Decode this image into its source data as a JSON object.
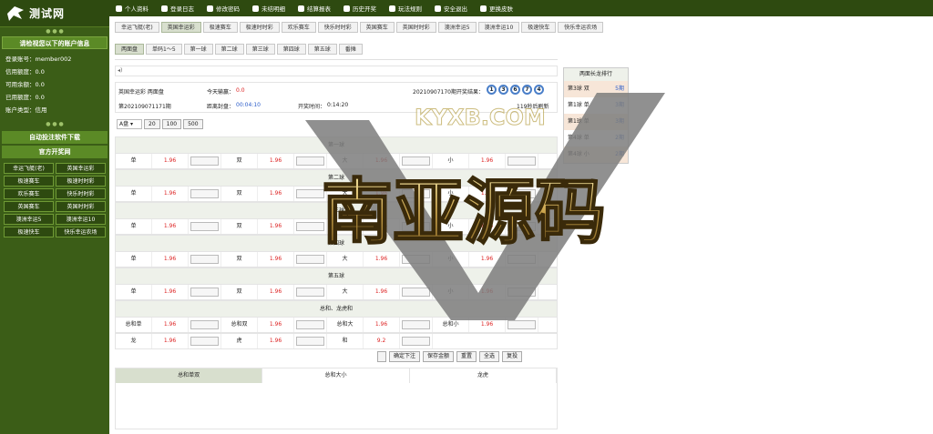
{
  "logo": {
    "name": "测试网"
  },
  "sidebar": {
    "acct_title": "请检视您以下的账户信息",
    "acct": [
      {
        "label": "登录账号：",
        "value": "member002"
      },
      {
        "label": "信用额度：",
        "value": "0.0"
      },
      {
        "label": "可用余额：",
        "value": "0.0"
      },
      {
        "label": "已用额度：",
        "value": "0.0"
      },
      {
        "label": "账户类型：",
        "value": "信用"
      }
    ],
    "download": "自动投注软件下载",
    "official": "官方开奖网",
    "games": [
      "幸运飞艇(老)",
      "英国幸运彩",
      "极速赛车",
      "极速时时彩",
      "欢乐赛车",
      "快乐时时彩",
      "英国赛车",
      "英国时时彩",
      "澳洲幸运5",
      "澳洲幸运10",
      "极速快车",
      "快乐幸运农场"
    ]
  },
  "topbar": [
    "个人资料",
    "登录日志",
    "修改密码",
    "未结明细",
    "结算报表",
    "历史开奖",
    "玩法规则",
    "安全退出",
    "更换皮肤"
  ],
  "tabs1": [
    "幸运飞艇(老)",
    "英国幸运彩",
    "极速赛车",
    "极速时时彩",
    "欢乐赛车",
    "快乐时时彩",
    "英国赛车",
    "英国时时彩",
    "澳洲幸运5",
    "澳洲幸运10",
    "极速快车",
    "快乐幸运农场"
  ],
  "tabs2": [
    "两面盘",
    "单码1～5",
    "第一球",
    "第二球",
    "第三球",
    "第四球",
    "第五球",
    "番摊"
  ],
  "info": {
    "game": "英国幸运彩 两面盘",
    "today_label": "今天输赢：",
    "today_value": "0.0",
    "draw_title": "20210907170期开奖结果：",
    "balls": [
      "1",
      "3",
      "6",
      "7",
      "4"
    ],
    "period": "第202109071171期",
    "close_label": "距离封盘：",
    "close_value": "00:04:10",
    "open_label": "开奖时间：",
    "open_value": "0:14:20",
    "refresh": "119秒后刷新"
  },
  "controls": {
    "plate": "A盘",
    "chips": [
      "20",
      "100",
      "500"
    ]
  },
  "sections": [
    {
      "title": "第一球",
      "cells": [
        [
          "单",
          "1.96"
        ],
        [
          "双",
          "1.96"
        ],
        [
          "大",
          "1.96"
        ],
        [
          "小",
          "1.96"
        ]
      ]
    },
    {
      "title": "第二球",
      "cells": [
        [
          "单",
          "1.96"
        ],
        [
          "双",
          "1.96"
        ],
        [
          "大",
          "1.96"
        ],
        [
          "小",
          "1.96"
        ]
      ]
    },
    {
      "title": "第三球",
      "cells": [
        [
          "单",
          "1.96"
        ],
        [
          "双",
          "1.96"
        ],
        [
          "大",
          "1.96"
        ],
        [
          "小",
          "1.96"
        ]
      ]
    },
    {
      "title": "第四球",
      "cells": [
        [
          "单",
          "1.96"
        ],
        [
          "双",
          "1.96"
        ],
        [
          "大",
          "1.96"
        ],
        [
          "小",
          "1.96"
        ]
      ]
    },
    {
      "title": "第五球",
      "cells": [
        [
          "单",
          "1.96"
        ],
        [
          "双",
          "1.96"
        ],
        [
          "大",
          "1.96"
        ],
        [
          "小",
          "1.96"
        ]
      ]
    }
  ],
  "total": {
    "title": "总和、龙虎和",
    "row1": [
      [
        "总和单",
        "1.96"
      ],
      [
        "总和双",
        "1.96"
      ],
      [
        "总和大",
        "1.96"
      ],
      [
        "总和小",
        "1.96"
      ]
    ],
    "row2": [
      [
        "龙",
        "1.96"
      ],
      [
        "虎",
        "1.96"
      ],
      [
        "和",
        "9.2"
      ]
    ]
  },
  "actions": [
    "确定下注",
    "保存金额",
    "重置",
    "全选",
    "复投"
  ],
  "summary": {
    "tabs": [
      "总和单双",
      "总和大小",
      "龙虎"
    ]
  },
  "rank": {
    "title": "两面长龙排行",
    "items": [
      [
        "第3球 双",
        "5期"
      ],
      [
        "第1球 单",
        "3期"
      ],
      [
        "第1球 单",
        "3期"
      ],
      [
        "第4球 单",
        "2期"
      ],
      [
        "第4球 小",
        "2期"
      ]
    ]
  },
  "watermark": {
    "top": "KYXB.COM",
    "main": "南亚源码"
  },
  "colors": {
    "sidebar": "#3b5d17",
    "topbar": "#2e4a10",
    "odds": "#dd2222",
    "ball": "#4a7fc9"
  }
}
